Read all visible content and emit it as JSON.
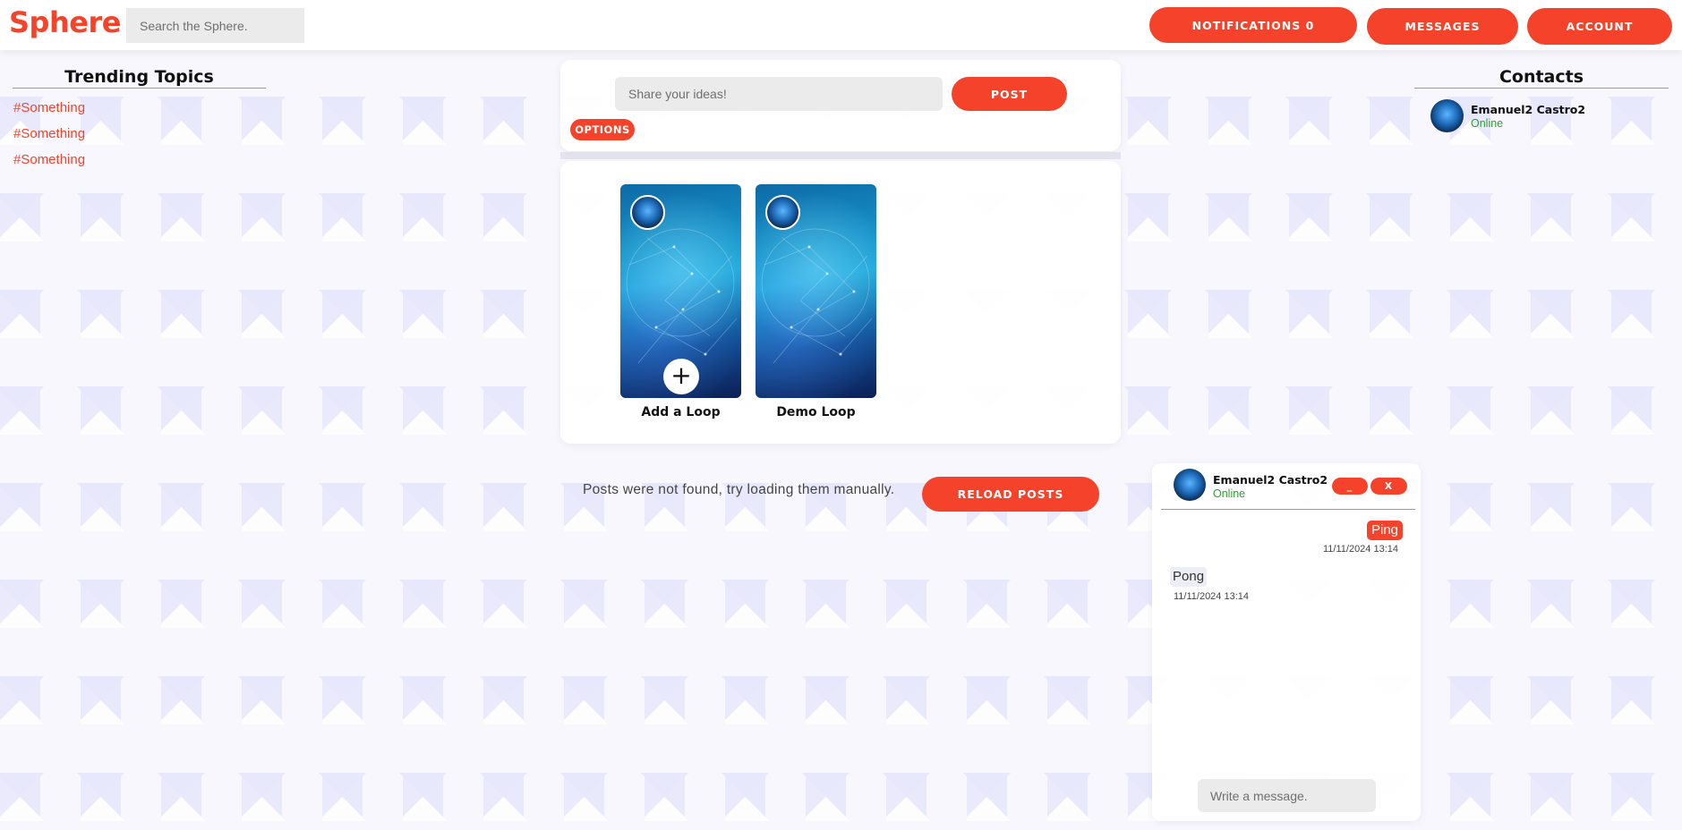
{
  "app": {
    "logo": "Sphere",
    "accent_color": "#f4432a"
  },
  "header": {
    "search_placeholder": "Search the Sphere.",
    "notifications_label": "NOTIFICATIONS 0",
    "messages_label": "MESSAGES",
    "account_label": "ACCOUNT"
  },
  "trending": {
    "title": "Trending Topics",
    "topics": [
      "#Something",
      "#Something",
      "#Something"
    ]
  },
  "composer": {
    "placeholder": "Share your ideas!",
    "post_label": "POST",
    "options_label": "OPTIONS"
  },
  "loops": {
    "items": [
      {
        "label": "Add a Loop",
        "icon": "plus-icon"
      },
      {
        "label": "Demo Loop",
        "icon": ""
      }
    ]
  },
  "feed": {
    "empty_message": "Posts were not found, try loading them manually.",
    "reload_label": "RELOAD POSTS"
  },
  "contacts": {
    "title": "Contacts",
    "items": [
      {
        "name": "Emanuel2 Castro2",
        "status": "Online"
      }
    ]
  },
  "chat": {
    "name": "Emanuel2 Castro2",
    "status": "Online",
    "minimize_label": "_",
    "close_label": "X",
    "messages": [
      {
        "text": "Ping",
        "time": "11/11/2024 13:14",
        "direction": "outgoing"
      },
      {
        "text": "Pong",
        "time": "11/11/2024 13:14",
        "direction": "incoming"
      }
    ],
    "input_placeholder": "Write a message."
  }
}
